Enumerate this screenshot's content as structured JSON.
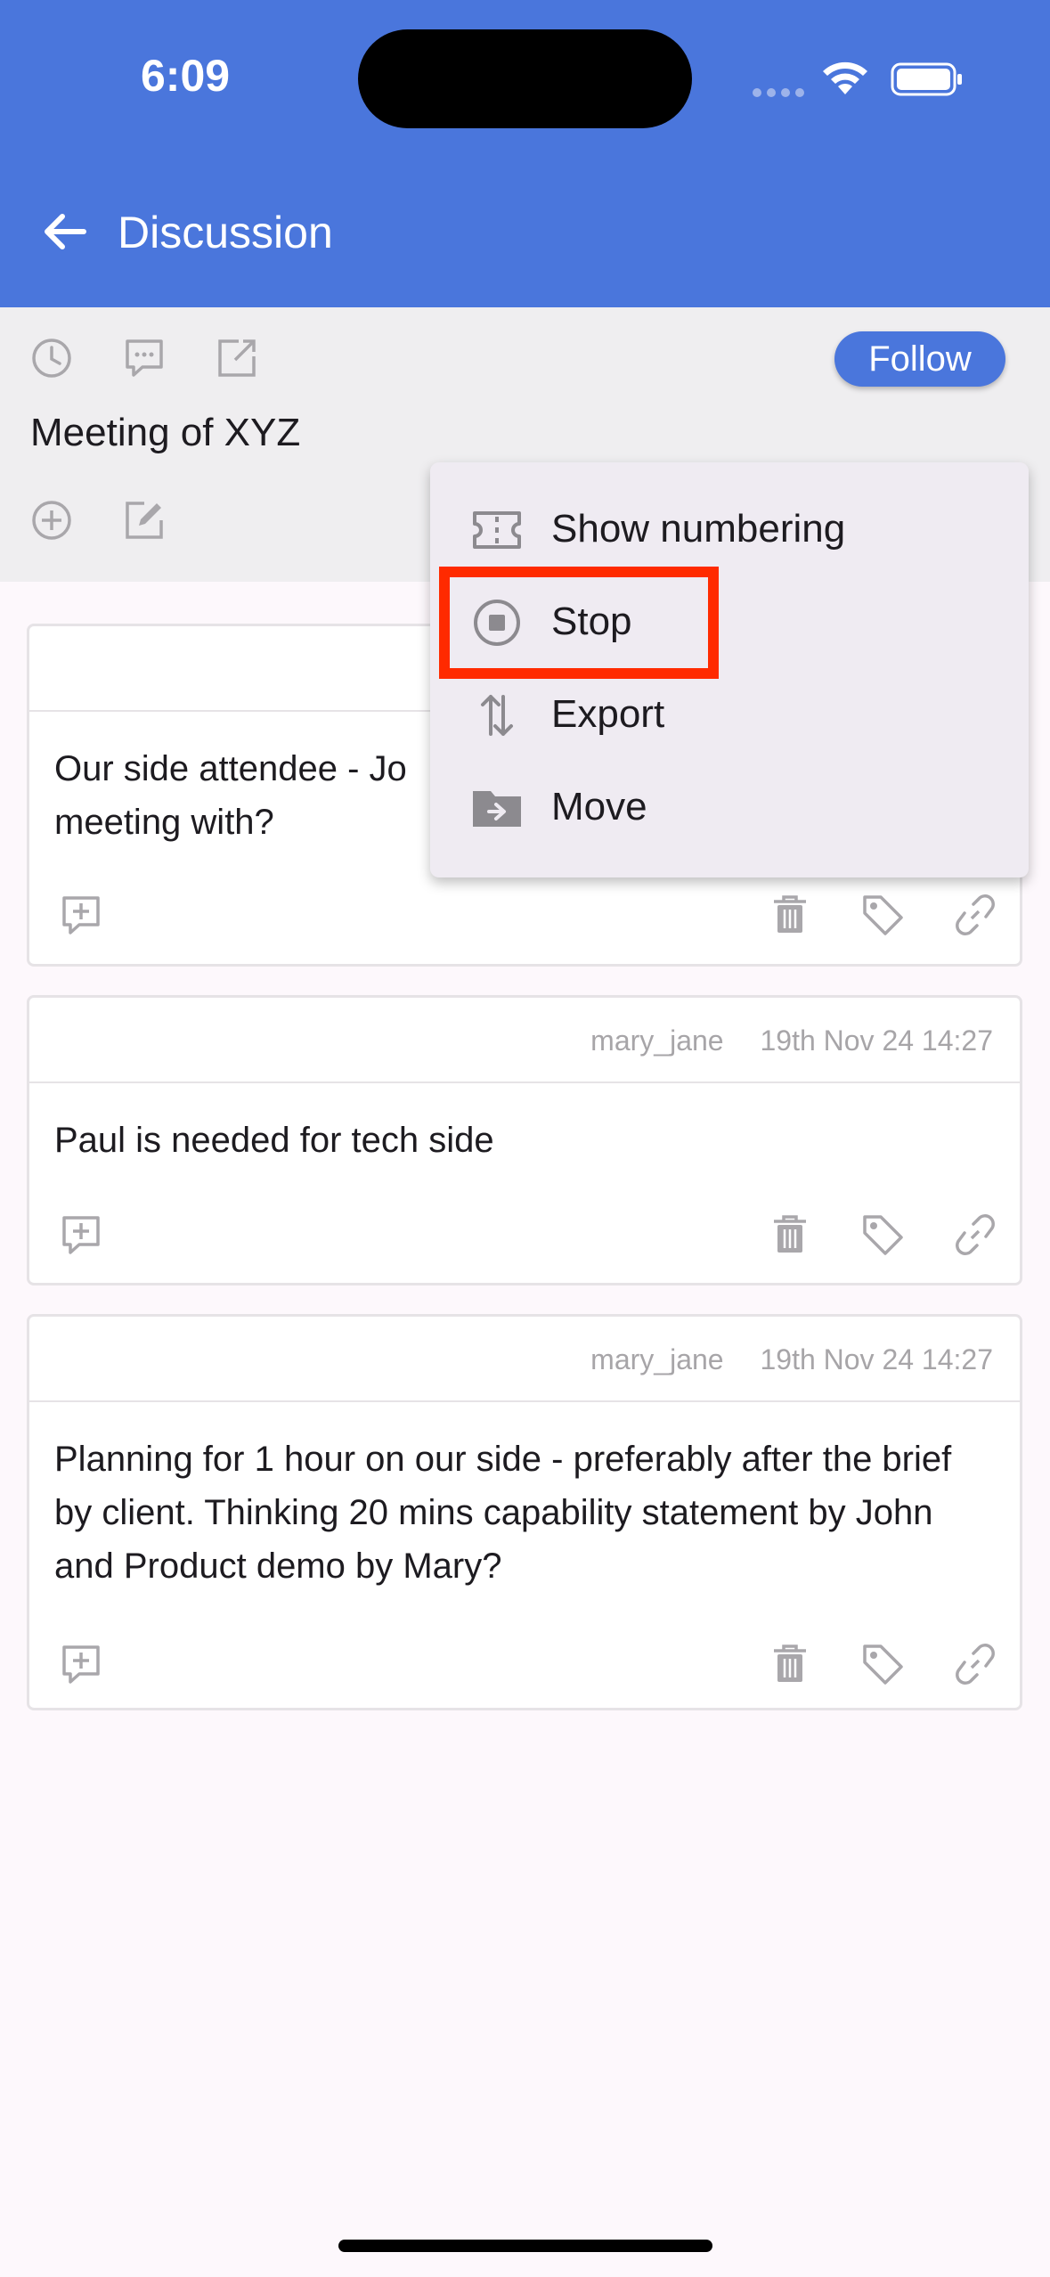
{
  "status_bar": {
    "time": "6:09"
  },
  "appbar": {
    "title": "Discussion"
  },
  "header": {
    "follow_label": "Follow",
    "meeting_title": "Meeting of XYZ"
  },
  "menu": {
    "items": [
      {
        "label": "Show numbering",
        "icon": "numbering-icon"
      },
      {
        "label": "Stop",
        "icon": "stop-icon"
      },
      {
        "label": "Export",
        "icon": "export-icon"
      },
      {
        "label": "Move",
        "icon": "move-folder-icon"
      }
    ],
    "highlighted_item": "Stop"
  },
  "posts": [
    {
      "author": "",
      "timestamp": "",
      "text": "Our side attendee - Jo meeting with?"
    },
    {
      "author": "mary_jane",
      "timestamp": "19th Nov 24 14:27",
      "text": "Paul is needed for tech side"
    },
    {
      "author": "mary_jane",
      "timestamp": "19th Nov 24 14:27",
      "text": "Planning for 1 hour on our side - preferably after the brief by client. Thinking 20 mins capability statement by John and Product demo by Mary?"
    }
  ],
  "colors": {
    "primary": "#4a76dc",
    "highlight": "#ff2a00",
    "icon_grey": "#a9a7ab"
  }
}
